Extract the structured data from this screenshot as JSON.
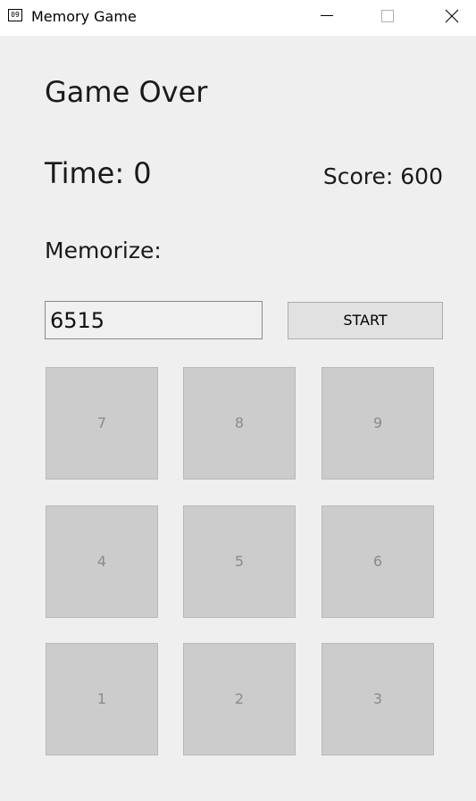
{
  "window": {
    "icon_text": "09",
    "title": "Memory Game"
  },
  "game": {
    "status": "Game Over",
    "time": "Time: 0",
    "score": "Score: 600",
    "memorize_label": "Memorize:",
    "code_value": "6515",
    "start_label": "START"
  },
  "keypad": {
    "keys": [
      {
        "label": "7"
      },
      {
        "label": "8"
      },
      {
        "label": "9"
      },
      {
        "label": "4"
      },
      {
        "label": "5"
      },
      {
        "label": "6"
      },
      {
        "label": "1"
      },
      {
        "label": "2"
      },
      {
        "label": "3"
      }
    ]
  }
}
